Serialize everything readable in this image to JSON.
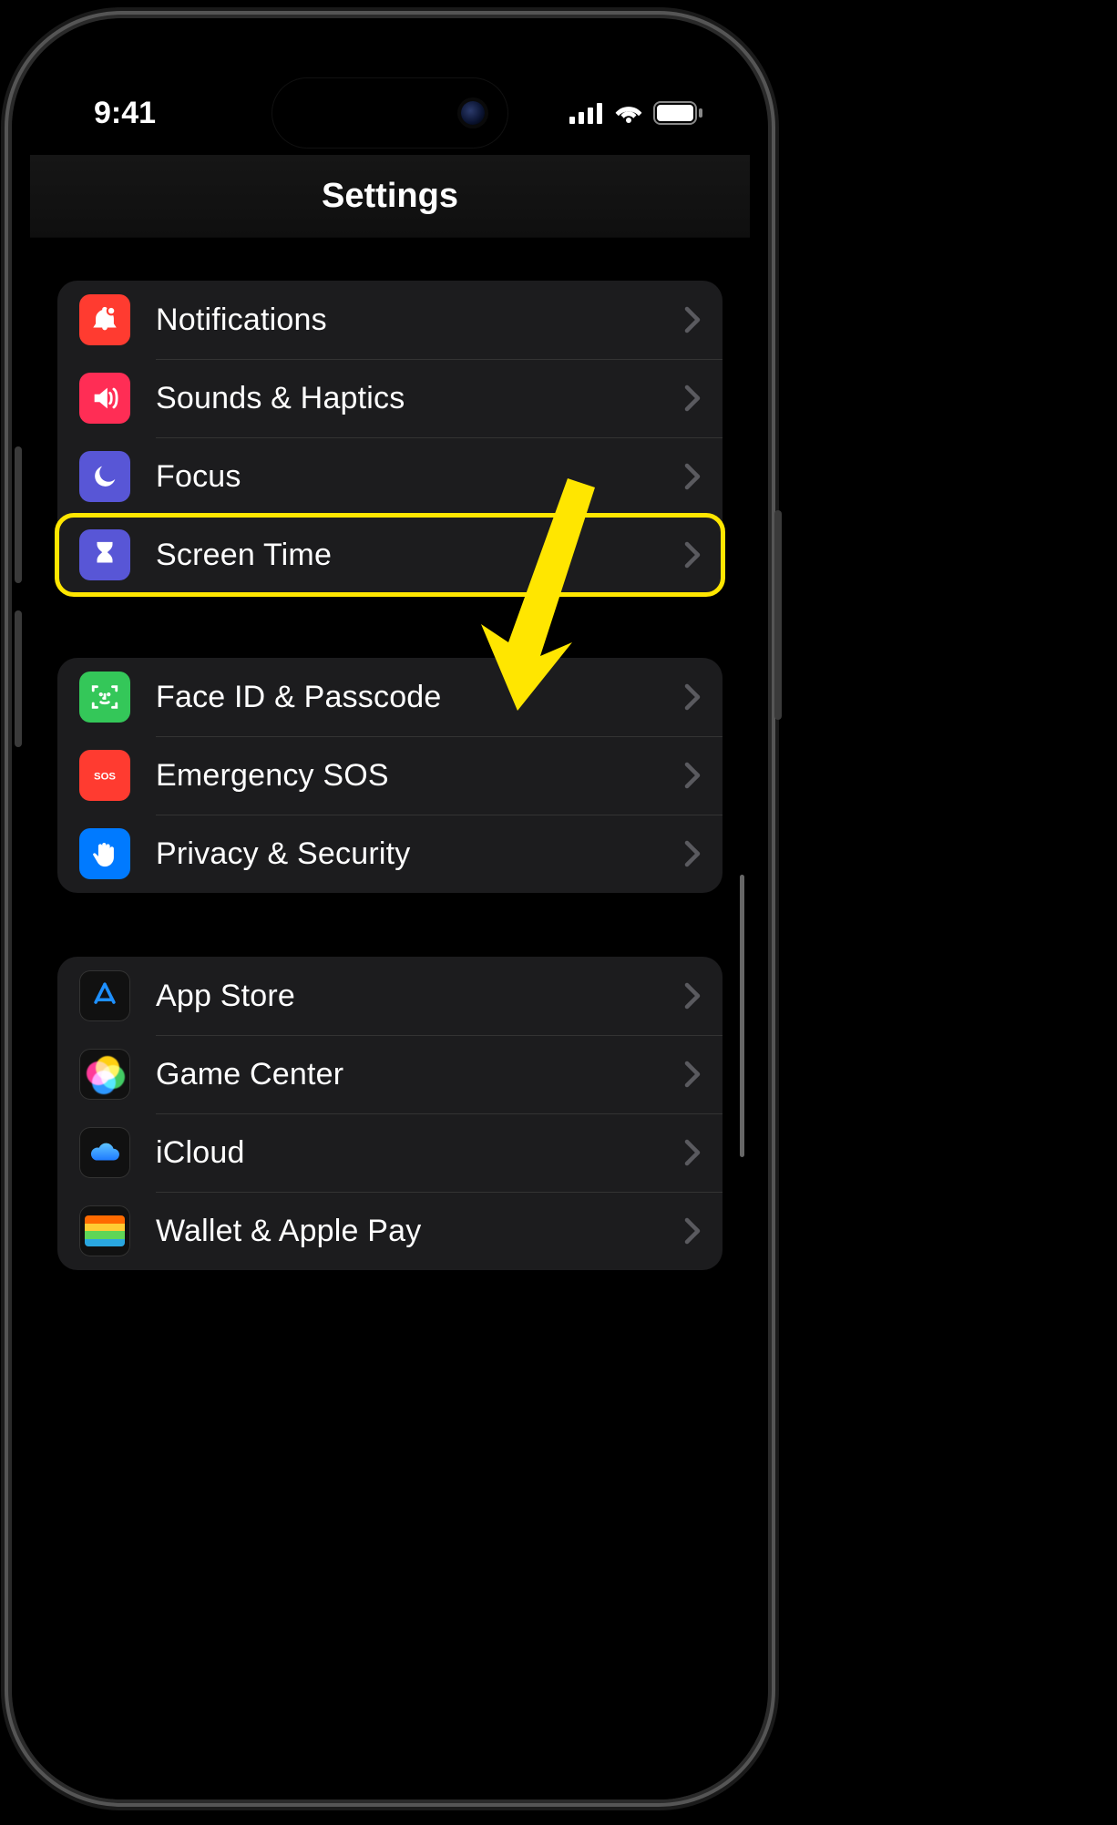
{
  "status": {
    "time": "9:41"
  },
  "header": {
    "title": "Settings"
  },
  "groups": [
    {
      "rows": [
        {
          "id": "notifications",
          "label": "Notifications",
          "icon": "bell-icon",
          "bg": "bg-red"
        },
        {
          "id": "sounds",
          "label": "Sounds & Haptics",
          "icon": "speaker-icon",
          "bg": "bg-pink"
        },
        {
          "id": "focus",
          "label": "Focus",
          "icon": "moon-icon",
          "bg": "bg-indigo"
        },
        {
          "id": "screentime",
          "label": "Screen Time",
          "icon": "hourglass-icon",
          "bg": "bg-indigo",
          "highlight": true
        }
      ]
    },
    {
      "rows": [
        {
          "id": "faceid",
          "label": "Face ID & Passcode",
          "icon": "faceid-icon",
          "bg": "bg-green"
        },
        {
          "id": "sos",
          "label": "Emergency SOS",
          "icon": "sos-icon",
          "bg": "bg-red"
        },
        {
          "id": "privacy",
          "label": "Privacy & Security",
          "icon": "hand-icon",
          "bg": "bg-blue"
        }
      ]
    },
    {
      "rows": [
        {
          "id": "appstore",
          "label": "App Store",
          "icon": "appstore-icon",
          "bg": "bg-dark"
        },
        {
          "id": "gamecenter",
          "label": "Game Center",
          "icon": "gamecenter-icon",
          "bg": "bg-dark"
        },
        {
          "id": "icloud",
          "label": "iCloud",
          "icon": "cloud-icon",
          "bg": "bg-dark"
        },
        {
          "id": "wallet",
          "label": "Wallet & Apple Pay",
          "icon": "wallet-icon",
          "bg": "bg-dark"
        }
      ]
    }
  ],
  "annotation": {
    "target": "screentime",
    "highlight_color": "#ffe600"
  }
}
